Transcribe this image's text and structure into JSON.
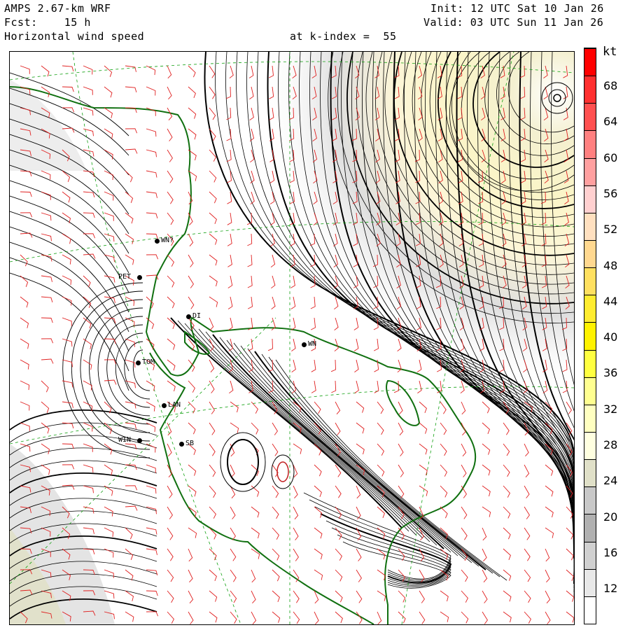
{
  "header": {
    "model": "AMPS 2.67-km WRF",
    "fcst": "Fcst:    15 h",
    "field": "Horizontal wind speed",
    "level": "at k-index =  55",
    "init": "Init: 12 UTC Sat 10 Jan 26",
    "valid": "Valid: 03 UTC Sun 11 Jan 26"
  },
  "colorbar": {
    "unit": "kt",
    "labels": [
      "68",
      "64",
      "60",
      "56",
      "52",
      "48",
      "44",
      "40",
      "36",
      "32",
      "28",
      "24",
      "20",
      "16",
      "12"
    ],
    "colors": [
      "#ff0000",
      "#ff3030",
      "#ff5050",
      "#ff8080",
      "#ffa0a0",
      "#ffd0d0",
      "#ffe0c0",
      "#ffd890",
      "#ffe060",
      "#ffec30",
      "#fff200",
      "#ffff40",
      "#ffff90",
      "#ffffc0",
      "#ffffe0",
      "#e0e0c8",
      "#c8c8c8",
      "#b0b0b0",
      "#d0d0d0",
      "#e8e8e8",
      "#ffffff"
    ]
  },
  "stations": [
    {
      "label": "WN?",
      "code": "wn"
    },
    {
      "label": "PET",
      "code": "pet"
    },
    {
      "label": "DI",
      "code": "di"
    },
    {
      "label": "TOM",
      "code": "tom"
    },
    {
      "label": "LAN",
      "code": "lan"
    },
    {
      "label": "WIN",
      "code": "win"
    },
    {
      "label": "SB",
      "code": "sb"
    },
    {
      "label": "WN",
      "code": "wn2"
    }
  ],
  "colors": {
    "coastline": "#107010",
    "barbs": "#e02020",
    "grid": "#10a010",
    "contours": "#000000"
  }
}
